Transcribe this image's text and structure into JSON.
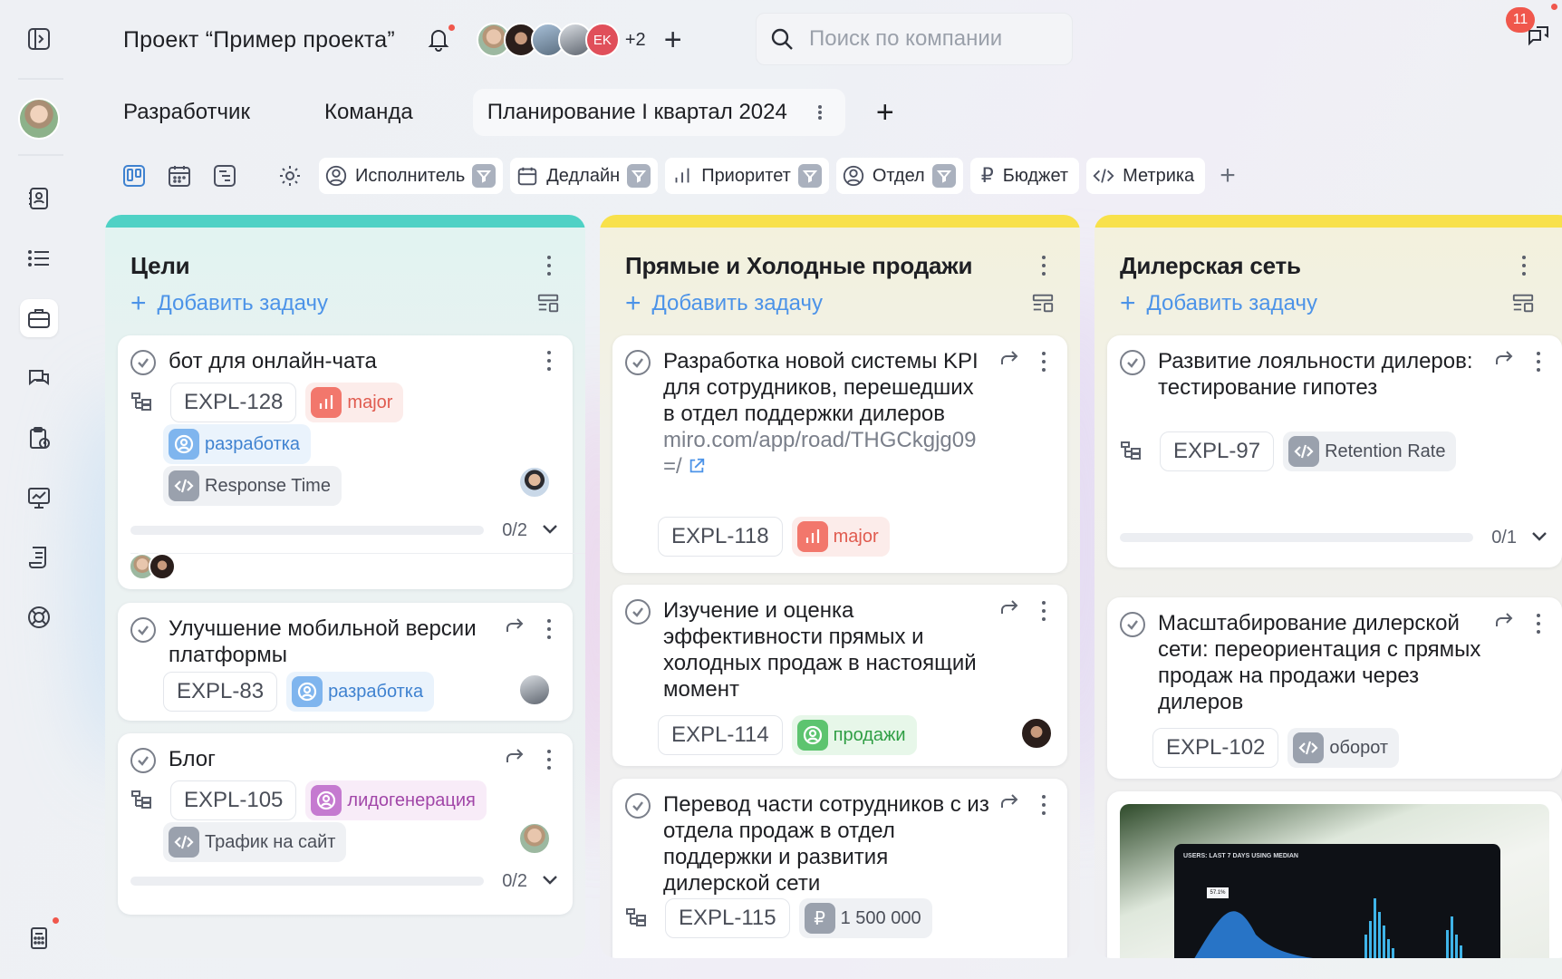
{
  "header": {
    "project_title": "Проект “Пример проекта”",
    "extra_members": "+2",
    "member_initials": "EK",
    "search_placeholder": "Поиск по компании",
    "notif_count": "11"
  },
  "tabs": [
    {
      "label": "Разработчик"
    },
    {
      "label": "Команда"
    },
    {
      "label": "Планирование I квартал 2024"
    }
  ],
  "filters": [
    {
      "label": "Исполнитель"
    },
    {
      "label": "Дедлайн"
    },
    {
      "label": "Приоритет"
    },
    {
      "label": "Отдел"
    },
    {
      "label": "Бюджет"
    },
    {
      "label": "Метрика"
    }
  ],
  "add_task_label": "Добавить задачу",
  "colors": {
    "goals_accent": "#4fd1c5",
    "sales_accent": "#f8e14b",
    "dealer_accent": "#f8e14b",
    "link": "#4c93e8"
  },
  "columns": [
    {
      "title": "Цели",
      "cards": [
        {
          "title": "бот для онлайн-чата",
          "code": "EXPL-128",
          "tags": [
            "major",
            "разработка",
            "Response Time"
          ],
          "progress": "0/2"
        },
        {
          "title": "Улучшение мобильной версии платформы",
          "code": "EXPL-83",
          "tags": [
            "разработка"
          ]
        },
        {
          "title": "Блог",
          "code": "EXPL-105",
          "tags": [
            "лидогенерация",
            "Трафик на сайт"
          ],
          "progress": "0/2"
        }
      ]
    },
    {
      "title": "Прямые и Холодные продажи",
      "cards": [
        {
          "title": "Разработка новой системы KPI для сотрудников, перешедших в отдел поддержки дилеров",
          "link": "miro.com/app/road/THGCkgjg09=/",
          "code": "EXPL-118",
          "tags": [
            "major"
          ]
        },
        {
          "title": "Изучение и оценка эффективности прямых и холодных продаж в настоящий момент",
          "code": "EXPL-114",
          "tags": [
            "продажи"
          ]
        },
        {
          "title": "Перевод части сотрудников с из отдела продаж в отдел поддержки и развития дилерской сети",
          "code": "EXPL-115",
          "tags": [
            "1 500 000"
          ]
        }
      ]
    },
    {
      "title": "Дилерская сеть",
      "cards": [
        {
          "title": "Развитие лояльности дилеров: тестирование гипотез",
          "code": "EXPL-97",
          "tags": [
            "Retention Rate"
          ],
          "progress": "0/1"
        },
        {
          "title": "Масштабирование дилерской сети: переориентация с прямых продаж на продажи через дилеров",
          "code": "EXPL-102",
          "tags": [
            "оборот"
          ]
        }
      ],
      "image_card": {
        "caption": "USERS: LAST 7 DAYS USING MEDIAN",
        "value": "57.1%"
      }
    }
  ]
}
